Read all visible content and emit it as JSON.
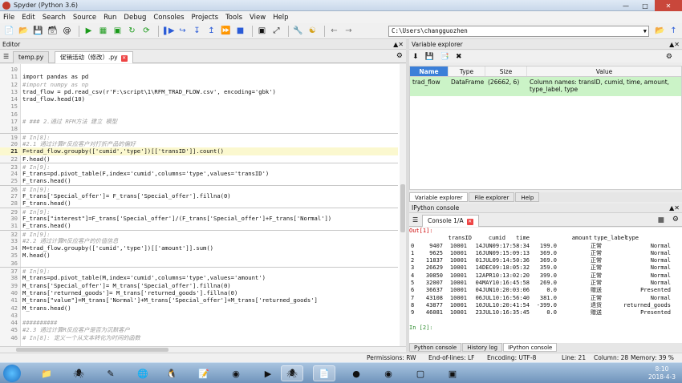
{
  "window": {
    "title": "Spyder (Python 3.6)"
  },
  "menu": [
    "File",
    "Edit",
    "Search",
    "Source",
    "Run",
    "Debug",
    "Consoles",
    "Projects",
    "Tools",
    "View",
    "Help"
  ],
  "toolbar": {
    "path": "C:\\Users\\changguozhen"
  },
  "editor": {
    "pane_title": "Editor",
    "tabs": [
      {
        "label": "temp.py"
      },
      {
        "label": "促销活动（修改）.py"
      }
    ],
    "lines": [
      {
        "n": "10",
        "t": ""
      },
      {
        "n": "11",
        "t": "import pandas as pd"
      },
      {
        "n": "12",
        "t": "#import numpy as np"
      },
      {
        "n": "13",
        "t": "trad_flow = pd.read_csv(r'F:\\script\\1\\RFM_TRAD_FLOW.csv', encoding='gbk')"
      },
      {
        "n": "14",
        "t": "trad_flow.head(10)"
      },
      {
        "n": "15",
        "t": ""
      },
      {
        "n": "16",
        "t": ""
      },
      {
        "n": "17",
        "t": "# ### 2.通过 RFM方法 建立 模型"
      },
      {
        "n": "18",
        "t": ""
      },
      {
        "n": "19",
        "t": "# In[8]:"
      },
      {
        "n": "20",
        "t": "#2.1 通过计算F反应客户对打折产品的偏好"
      },
      {
        "n": "21",
        "t": "F=trad_flow.groupby(['cumid','type'])[['transID']].count()"
      },
      {
        "n": "22",
        "t": "F.head()"
      },
      {
        "n": "23",
        "t": "# In[9]:"
      },
      {
        "n": "24",
        "t": "F_trans=pd.pivot_table(F,index='cumid',columns='type',values='transID')"
      },
      {
        "n": "25",
        "t": "F_trans.head()"
      },
      {
        "n": "26",
        "t": "# In[9]:"
      },
      {
        "n": "27",
        "t": "F_trans['Special_offer']= F_trans['Special_offer'].fillna(0)"
      },
      {
        "n": "28",
        "t": "F_trans.head()"
      },
      {
        "n": "29",
        "t": "# In[9]:"
      },
      {
        "n": "30",
        "t": "F_trans[\"interest\"]=F_trans['Special_offer']/(F_trans['Special_offer']+F_trans['Normal'])"
      },
      {
        "n": "31",
        "t": "F_trans.head()"
      },
      {
        "n": "32",
        "t": "# In[9]:"
      },
      {
        "n": "33",
        "t": "#2.2 通过计算M反应客户的价值信息"
      },
      {
        "n": "34",
        "t": "M=trad_flow.groupby(['cumid','type'])[['amount']].sum()"
      },
      {
        "n": "35",
        "t": "M.head()"
      },
      {
        "n": "36",
        "t": ""
      },
      {
        "n": "37",
        "t": "# In[9]:"
      },
      {
        "n": "38",
        "t": "M_trans=pd.pivot_table(M,index='cumid',columns='type',values='amount')"
      },
      {
        "n": "39",
        "t": "M_trans['Special_offer']= M_trans['Special_offer'].fillna(0)"
      },
      {
        "n": "40",
        "t": "M_trans['returned_goods']= M_trans['returned_goods'].fillna(0)"
      },
      {
        "n": "41",
        "t": "M_trans[\"value\"]=M_trans['Normal']+M_trans['Special_offer']+M_trans['returned_goods']"
      },
      {
        "n": "42",
        "t": "M_trans.head()"
      },
      {
        "n": "43",
        "t": ""
      },
      {
        "n": "44",
        "t": "##########"
      },
      {
        "n": "45",
        "t": "#2.3 通过计算R反应客户是否为沉默客户"
      },
      {
        "n": "46",
        "t": "# In[8]: 定义一个从文本转化为时间的函数"
      }
    ]
  },
  "variable_explorer": {
    "pane_title": "Variable explorer",
    "headers": [
      "Name",
      "Type",
      "Size",
      "Value"
    ],
    "row": {
      "name": "trad_flow",
      "type": "DataFrame",
      "size": "(26662, 6)",
      "value": "Column names: transID, cumid, time, amount, type_label, type"
    },
    "tabs": [
      "Variable explorer",
      "File explorer",
      "Help"
    ]
  },
  "ipython": {
    "pane_title": "IPython console",
    "tab": "Console 1/A",
    "out_label": "Out[1]:",
    "columns": [
      "transID",
      "cumid",
      "time",
      "amount",
      "type_label",
      "type"
    ],
    "rows": [
      [
        "0",
        "9407",
        "10001",
        "14JUN09:17:58:34",
        "199.0",
        "正常",
        "Normal"
      ],
      [
        "1",
        "9625",
        "10001",
        "16JUN09:15:09:13",
        "369.0",
        "正常",
        "Normal"
      ],
      [
        "2",
        "11837",
        "10001",
        "01JUL09:14:50:36",
        "369.0",
        "正常",
        "Normal"
      ],
      [
        "3",
        "26629",
        "10001",
        "14DEC09:18:05:32",
        "359.0",
        "正常",
        "Normal"
      ],
      [
        "4",
        "30850",
        "10001",
        "12APR10:13:02:20",
        "399.0",
        "正常",
        "Normal"
      ],
      [
        "5",
        "32007",
        "10001",
        "04MAY10:16:45:58",
        "269.0",
        "正常",
        "Normal"
      ],
      [
        "6",
        "36637",
        "10001",
        "04JUN10:20:03:06",
        "0.0",
        "赠送",
        "Presented"
      ],
      [
        "7",
        "43108",
        "10001",
        "06JUL10:16:56:40",
        "381.0",
        "正常",
        "Normal"
      ],
      [
        "8",
        "43877",
        "10001",
        "10JUL10:20:41:54",
        "-399.0",
        "退货",
        "returned_goods"
      ],
      [
        "9",
        "46081",
        "10001",
        "23JUL10:16:35:45",
        "0.0",
        "赠送",
        "Presented"
      ]
    ],
    "prompt": "In [2]:",
    "bottom_tabs": [
      "Python console",
      "History log",
      "IPython console"
    ]
  },
  "statusbar": {
    "permissions": "Permissions: RW",
    "eol": "End-of-lines: LF",
    "encoding": "Encoding: UTF-8",
    "line": "Line: 21",
    "column": "Column: 28",
    "memory": "Memory: 39 %"
  },
  "taskbar": {
    "time": "8:10",
    "date": "2018-4-3"
  }
}
